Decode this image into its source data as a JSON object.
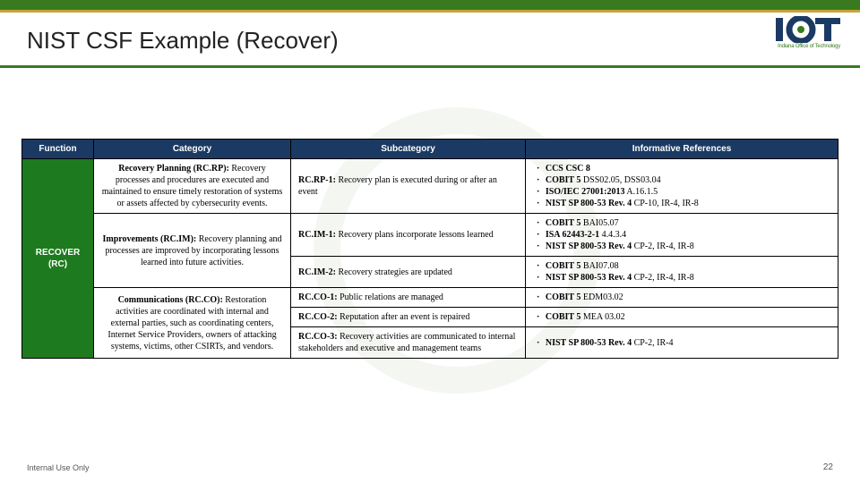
{
  "title": "NIST CSF Example (Recover)",
  "logo_tag": "Indiana Office of Technology",
  "footer_left": "Internal Use Only",
  "footer_right": "22",
  "headers": {
    "function": "Function",
    "category": "Category",
    "subcategory": "Subcategory",
    "references": "Informative References"
  },
  "function_label": "RECOVER (RC)",
  "rows": [
    {
      "category_bold": "Recovery Planning (RC.RP):",
      "category_rest": " Recovery processes and procedures are executed and maintained to ensure timely restoration of systems or assets affected by cybersecurity events.",
      "subs": [
        {
          "sub_bold": "RC.RP-1:",
          "sub_rest": " Recovery plan is executed during or after an event",
          "refs": [
            {
              "b": "CCS CSC 8",
              "r": ""
            },
            {
              "b": "COBIT 5",
              "r": " DSS02.05, DSS03.04"
            },
            {
              "b": "ISO/IEC 27001:2013",
              "r": " A.16.1.5"
            },
            {
              "b": "NIST SP 800-53 Rev. 4",
              "r": " CP-10, IR-4, IR-8"
            }
          ]
        }
      ]
    },
    {
      "category_bold": "Improvements (RC.IM):",
      "category_rest": " Recovery planning and processes are improved by incorporating lessons learned into future activities.",
      "subs": [
        {
          "sub_bold": "RC.IM-1:",
          "sub_rest": " Recovery plans incorporate lessons learned",
          "refs": [
            {
              "b": "COBIT 5",
              "r": " BAI05.07"
            },
            {
              "b": "ISA 62443-2-1",
              "r": " 4.4.3.4"
            },
            {
              "b": "NIST SP 800-53 Rev. 4",
              "r": " CP-2, IR-4, IR-8"
            }
          ]
        },
        {
          "sub_bold": "RC.IM-2:",
          "sub_rest": " Recovery strategies are updated",
          "refs": [
            {
              "b": "COBIT 5",
              "r": " BAI07.08"
            },
            {
              "b": "NIST SP 800-53 Rev. 4",
              "r": " CP-2, IR-4, IR-8"
            }
          ]
        }
      ]
    },
    {
      "category_bold": "Communications (RC.CO):",
      "category_rest": " Restoration activities are coordinated with internal and external parties, such as coordinating centers, Internet Service Providers, owners of attacking systems, victims, other CSIRTs, and vendors.",
      "subs": [
        {
          "sub_bold": "RC.CO-1:",
          "sub_rest": " Public relations are managed",
          "refs": [
            {
              "b": "COBIT 5",
              "r": " EDM03.02"
            }
          ]
        },
        {
          "sub_bold": "RC.CO-2:",
          "sub_rest": " Reputation after an event is repaired",
          "refs": [
            {
              "b": "COBIT 5",
              "r": " MEA 03.02"
            }
          ]
        },
        {
          "sub_bold": "RC.CO-3:",
          "sub_rest": " Recovery activities are communicated to internal stakeholders and executive and management teams",
          "refs": [
            {
              "b": "NIST SP 800-53 Rev. 4",
              "r": " CP-2, IR-4"
            }
          ]
        }
      ]
    }
  ]
}
